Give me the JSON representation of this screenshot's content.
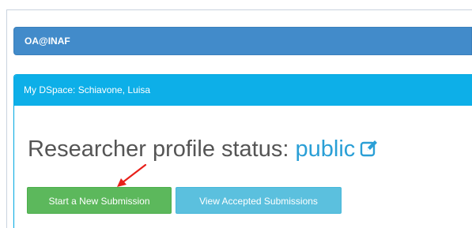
{
  "header": {
    "brand": "OA@INAF"
  },
  "panel": {
    "heading": "My DSpace: Schiavone, Luisa",
    "status_label": "Researcher profile status: ",
    "status_value": "public"
  },
  "actions": {
    "new_submission": "Start a New Submission",
    "view_accepted": "View Accepted Submissions"
  },
  "colors": {
    "brand_bar": "#428bca",
    "panel_heading": "#0dafe8",
    "status_value": "#2a9fd6",
    "submit_button": "#5cb85c",
    "accepted_button": "#5bc0de",
    "annotation_arrow": "#e8201a"
  },
  "icons": {
    "edit": "pencil-square-icon",
    "annotation": "red-arrow-icon"
  }
}
